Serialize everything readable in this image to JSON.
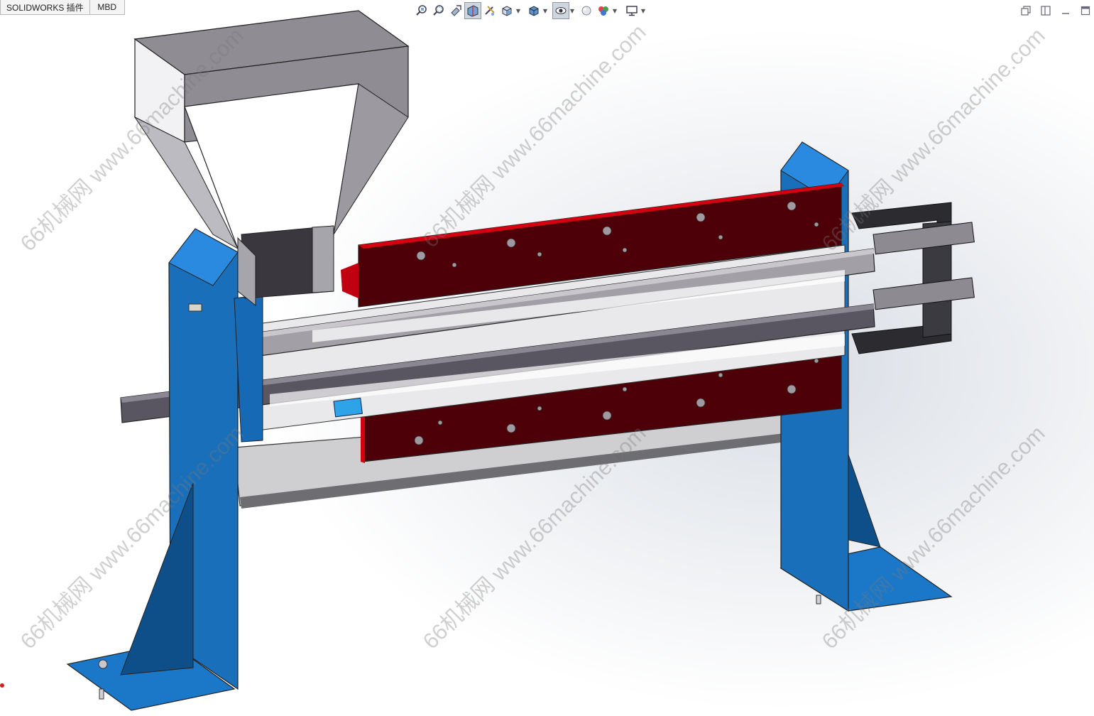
{
  "tabs": [
    {
      "label": "SOLIDWORKS 插件"
    },
    {
      "label": "MBD"
    }
  ],
  "toolbar": {
    "icons": [
      "zoom-to-fit-icon",
      "zoom-to-area-icon",
      "previous-view-icon",
      "section-view-icon",
      "dynamic-annotation-icon",
      "view-orientation-icon",
      "display-style-icon",
      "hide-show-items-icon",
      "edit-appearance-icon",
      "apply-scene-icon",
      "view-settings-icon"
    ]
  },
  "watermark": {
    "text": "66机械网 www.66machine.com"
  },
  "colors": {
    "frame_blue": "#1f7fd1",
    "barrel_red": "#5a0008",
    "hopper_gray": "#8f8c94",
    "screw_gray": "#a7a3ab"
  }
}
